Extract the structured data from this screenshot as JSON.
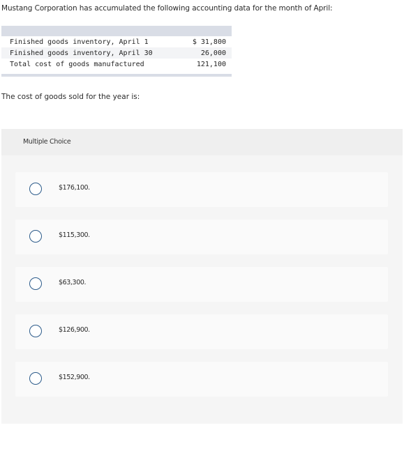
{
  "intro_text": "Mustang Corporation has accumulated the following accounting data for the month of April:",
  "table": {
    "rows": [
      {
        "label": "Finished goods inventory, April 1",
        "value": "$ 31,800"
      },
      {
        "label": "Finished goods inventory, April 30",
        "value": "26,000"
      },
      {
        "label": "Total cost of goods manufactured",
        "value": "121,100"
      }
    ]
  },
  "question_text": "The cost of goods sold for the year is:",
  "multiple_choice": {
    "title": "Multiple Choice",
    "options": [
      {
        "label": "$176,100.",
        "selected": false
      },
      {
        "label": "$115,300.",
        "selected": false
      },
      {
        "label": "$63,300.",
        "selected": false
      },
      {
        "label": "$126,900.",
        "selected": false
      },
      {
        "label": "$152,900.",
        "selected": false
      }
    ]
  },
  "colors": {
    "radio_border": "#2c5b8a",
    "table_bar": "#d9dde6",
    "panel_bg": "#f5f5f5",
    "option_bg": "#fafafa"
  }
}
